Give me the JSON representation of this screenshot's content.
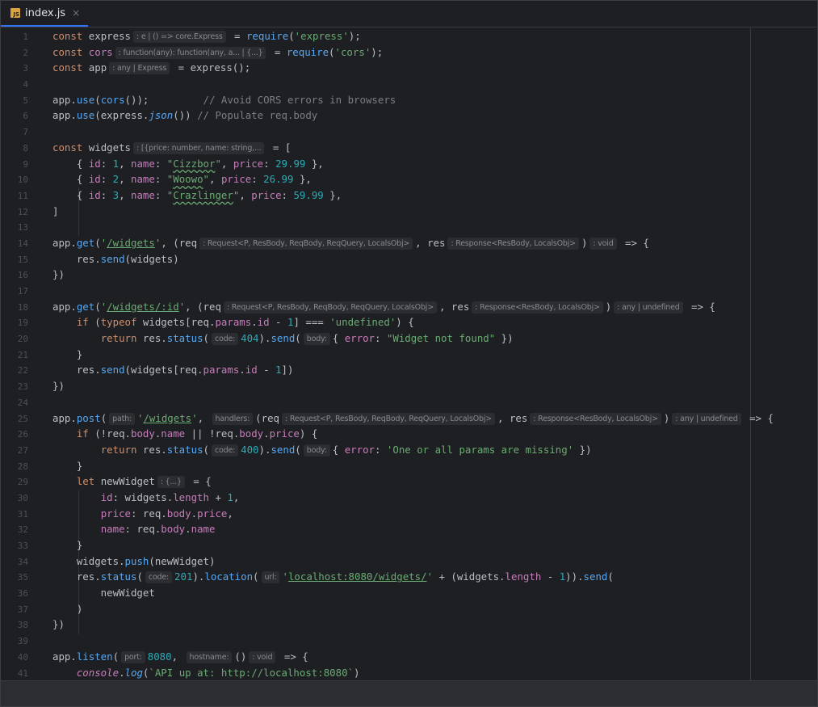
{
  "tab": {
    "icon": "JS",
    "filename": "index.js",
    "close": "×"
  },
  "hints": {
    "express": ": e | () => core.Express",
    "cors": ": function(any): function(any, a... | {...}",
    "app": ": any | Express",
    "widgets": ": [{price: number, name: string,...",
    "req": ": Request<P, ResBody, ReqBody, ReqQuery, LocalsObj>",
    "res": ": Response<ResBody, LocalsObj>",
    "void": ": void",
    "anyUndef": ": any | undefined",
    "code": "code:",
    "body": "body:",
    "path": "path:",
    "handlers": "handlers:",
    "obj": ": {...}",
    "url": "url:",
    "port": "port:",
    "hostname": "hostname:"
  },
  "code": {
    "l1_kw": "const",
    "l1_name": "express",
    "l1_eq": " = ",
    "l1_fn": "require",
    "l1_str": "'express'",
    "l1_end": ");",
    "l2_kw": "const",
    "l2_name": "cors",
    "l2_str": "'cors'",
    "l3_kw": "const",
    "l3_name": "app",
    "l3_rest": " = express();",
    "l5_a": "app.",
    "l5_fn": "use",
    "l5_b": "(",
    "l5_fn2": "cors",
    "l5_c": "());",
    "l5_comment": "// Avoid CORS errors in browsers",
    "l6_a": "app.",
    "l6_fn": "use",
    "l6_b": "(express.",
    "l6_fn2": "json",
    "l6_c": "()) ",
    "l6_comment": "// Populate req.body",
    "l8_kw": "const",
    "l8_name": "widgets",
    "l8_rest": " = [",
    "w1_name": "Cizzbor",
    "w1_id": "1",
    "w1_price": "29.99",
    "w2_name": "Woowo",
    "w2_id": "2",
    "w2_price": "26.99",
    "w3_name": "Crazlinger",
    "w3_id": "3",
    "w3_price": "59.99",
    "l12": "]",
    "route_widgets": "/widgets",
    "route_widget_id": "/widgets/:id",
    "l20_code": "404",
    "l20_err": "\"Widget not found\"",
    "l27_code": "400",
    "l27_err": "'One or all params are missing'",
    "l29_name": "newWidget",
    "l35_code": "201",
    "l35_url": "localhost:8080/widgets/",
    "l40_port": "8080",
    "l41_log": "`API up at: http://localhost:8080`"
  }
}
